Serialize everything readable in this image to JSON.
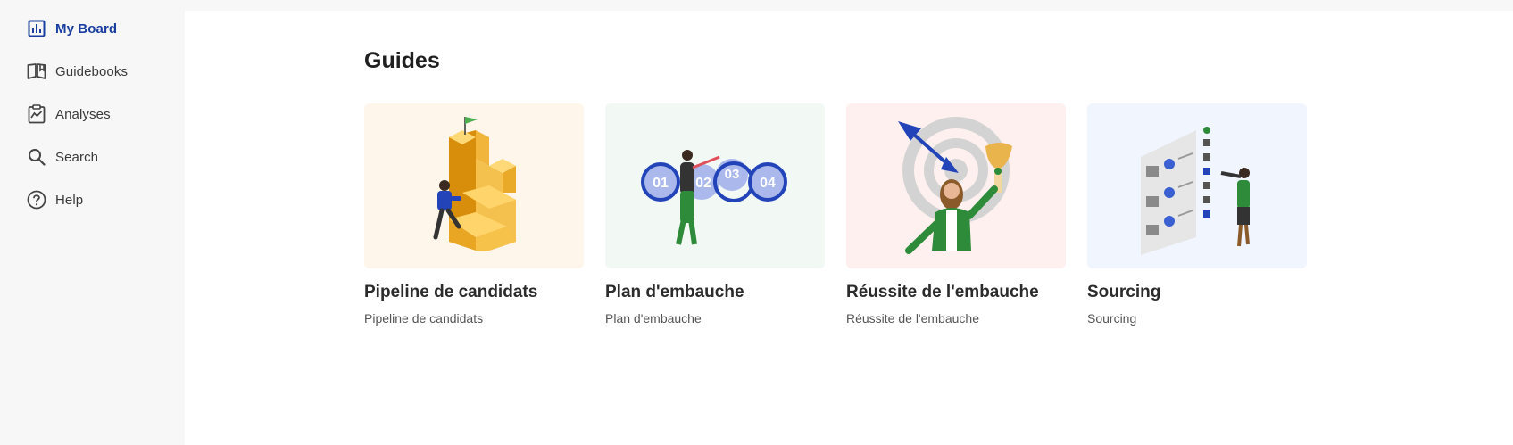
{
  "sidebar": {
    "items": [
      {
        "label": "My Board",
        "icon": "board-icon",
        "active": true
      },
      {
        "label": "Guidebooks",
        "icon": "book-icon",
        "active": false
      },
      {
        "label": "Analyses",
        "icon": "clipboard-chart-icon",
        "active": false
      },
      {
        "label": "Search",
        "icon": "search-icon",
        "active": false
      },
      {
        "label": "Help",
        "icon": "help-icon",
        "active": false
      }
    ]
  },
  "main": {
    "title": "Guides",
    "cards": [
      {
        "title": "Pipeline de candidats",
        "subtitle": "Pipeline de candidats",
        "background": "#fef6ea",
        "illustration": "stairs-climber-illustration"
      },
      {
        "title": "Plan d'embauche",
        "subtitle": "Plan d'embauche",
        "background": "#f2f8f3",
        "illustration": "steps-plan-illustration",
        "step_labels": [
          "01",
          "02",
          "03",
          "04"
        ]
      },
      {
        "title": "Réussite de l'embauche",
        "subtitle": "Réussite de l'embauche",
        "background": "#fdf0ee",
        "illustration": "target-trophy-illustration"
      },
      {
        "title": "Sourcing",
        "subtitle": "Sourcing",
        "background": "#f1f5fd",
        "illustration": "sourcing-telescope-illustration"
      }
    ]
  },
  "colors": {
    "accent": "#1a3fa0",
    "sidebar_bg": "#f7f7f7",
    "main_bg": "#ffffff"
  }
}
